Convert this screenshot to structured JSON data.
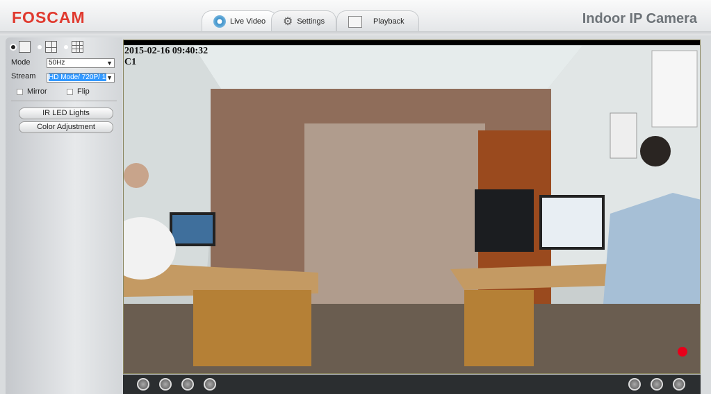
{
  "header": {
    "logo": "FOSCAM",
    "product": "Indoor IP Camera",
    "tabs": [
      {
        "label": "Live Video",
        "icon": "webcam-icon",
        "active": true
      },
      {
        "label": "Settings",
        "icon": "gears-icon"
      },
      {
        "label": "Playback",
        "icon": "calendar-icon"
      }
    ]
  },
  "sidebar": {
    "layouts": [
      {
        "name": "1-view",
        "selected": true
      },
      {
        "name": "4-view"
      },
      {
        "name": "9-view"
      }
    ],
    "mode_label": "Mode",
    "mode_value": "50Hz",
    "stream_label": "Stream",
    "stream_value": "HD Mode/ 720P/ 1(",
    "mirror_label": "Mirror",
    "flip_label": "Flip",
    "ir_button": "IR LED Lights",
    "color_button": "Color Adjustment"
  },
  "video": {
    "timestamp": "2015-02-16 09:40:32",
    "channel": "C1",
    "recording_color": "#e8001a"
  },
  "controls": {
    "left": [
      "play-icon",
      "stop-icon",
      "talk-icon",
      "audio-icon"
    ],
    "right": [
      "snapshot-icon",
      "record-icon",
      "fullscreen-icon"
    ]
  }
}
